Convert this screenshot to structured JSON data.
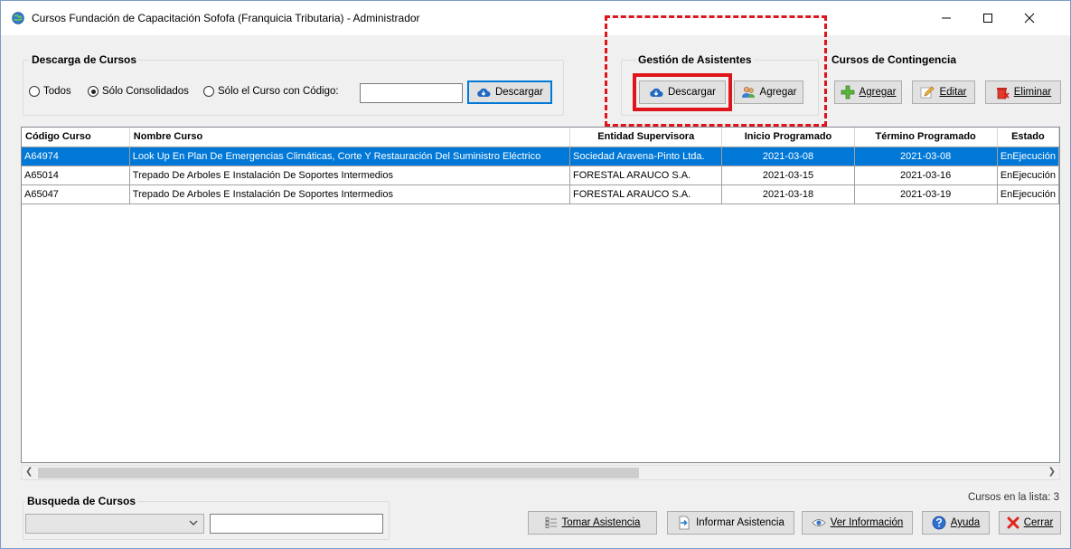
{
  "window": {
    "title": "Cursos Fundación de Capacitación Sofofa (Franquicia Tributaria) - Administrador",
    "controls": {
      "minimize": "minimize-icon",
      "maximize": "maximize-icon",
      "close": "close-icon"
    }
  },
  "descarga": {
    "legend": "Descarga de Cursos",
    "options": [
      {
        "label": "Todos",
        "selected": false
      },
      {
        "label": "Sólo Consolidados",
        "selected": true
      },
      {
        "label": "Sólo el Curso con Código:",
        "selected": false
      }
    ],
    "code_value": "",
    "download_label": "Descargar"
  },
  "asistentes": {
    "legend": "Gestión de Asistentes",
    "download_label": "Descargar",
    "add_label": "Agregar"
  },
  "contingencia": {
    "legend": "Cursos de Contingencia",
    "add_label": "Agregar",
    "edit_label": "Editar",
    "delete_label": "Eliminar"
  },
  "grid": {
    "columns": [
      "Código Curso",
      "Nombre Curso",
      "Entidad Supervisora",
      "Inicio Programado",
      "Término Programado",
      "Estado"
    ],
    "rows": [
      [
        "A64974",
        "Look Up En Plan De Emergencias Climáticas, Corte Y Restauración Del Suministro Eléctrico",
        "Sociedad Aravena-Pinto Ltda.",
        "2021-03-08",
        "2021-03-08",
        "EnEjecución"
      ],
      [
        "A65014",
        "Trepado De Arboles E Instalación De Soportes Intermedios",
        "FORESTAL ARAUCO S.A.",
        "2021-03-15",
        "2021-03-16",
        "EnEjecución"
      ],
      [
        "A65047",
        "Trepado De Arboles E Instalación De Soportes Intermedios",
        "FORESTAL ARAUCO S.A.",
        "2021-03-18",
        "2021-03-19",
        "EnEjecución"
      ]
    ],
    "selected_row": 0
  },
  "busqueda": {
    "legend": "Busqueda de Cursos",
    "combo_value": "",
    "text_value": ""
  },
  "status": {
    "count_text": "Cursos en la lista: 3"
  },
  "actions": {
    "tomar_label": "Tomar Asistencia",
    "informar_label": "Informar Asistencia",
    "ver_label": "Ver Información",
    "ayuda_label": "Ayuda",
    "cerrar_label": "Cerrar"
  },
  "colors": {
    "selection": "#0078d7",
    "annotation": "#e0151b",
    "focus_border": "#0078d7"
  }
}
